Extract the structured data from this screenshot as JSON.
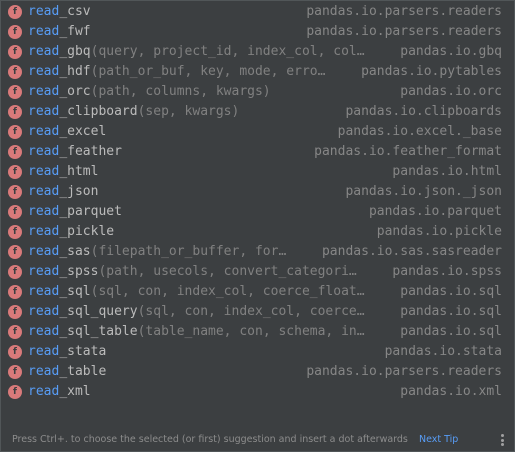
{
  "popup": {
    "match_prefix": "read",
    "icon_letter": "f",
    "items": [
      {
        "suffix": "_csv",
        "params": "",
        "location": "pandas.io.parsers.readers"
      },
      {
        "suffix": "_fwf",
        "params": "",
        "location": "pandas.io.parsers.readers"
      },
      {
        "suffix": "_gbq",
        "params": "(query, project_id, index_col, col…",
        "location": "pandas.io.gbq"
      },
      {
        "suffix": "_hdf",
        "params": "(path_or_buf, key, mode, erro…",
        "location": "pandas.io.pytables"
      },
      {
        "suffix": "_orc",
        "params": "(path, columns, kwargs)",
        "location": "pandas.io.orc"
      },
      {
        "suffix": "_clipboard",
        "params": "(sep, kwargs)",
        "location": "pandas.io.clipboards"
      },
      {
        "suffix": "_excel",
        "params": "",
        "location": "pandas.io.excel._base"
      },
      {
        "suffix": "_feather",
        "params": "",
        "location": "pandas.io.feather_format"
      },
      {
        "suffix": "_html",
        "params": "",
        "location": "pandas.io.html"
      },
      {
        "suffix": "_json",
        "params": "",
        "location": "pandas.io.json._json"
      },
      {
        "suffix": "_parquet",
        "params": "",
        "location": "pandas.io.parquet"
      },
      {
        "suffix": "_pickle",
        "params": "",
        "location": "pandas.io.pickle"
      },
      {
        "suffix": "_sas",
        "params": "(filepath_or_buffer, for…",
        "location": "pandas.io.sas.sasreader"
      },
      {
        "suffix": "_spss",
        "params": "(path, usecols, convert_categori…",
        "location": "pandas.io.spss"
      },
      {
        "suffix": "_sql",
        "params": "(sql, con, index_col, coerce_float…",
        "location": "pandas.io.sql"
      },
      {
        "suffix": "_sql_query",
        "params": "(sql, con, index_col, coerce…",
        "location": "pandas.io.sql"
      },
      {
        "suffix": "_sql_table",
        "params": "(table_name, con, schema, in…",
        "location": "pandas.io.sql"
      },
      {
        "suffix": "_stata",
        "params": "",
        "location": "pandas.io.stata"
      },
      {
        "suffix": "_table",
        "params": "",
        "location": "pandas.io.parsers.readers"
      },
      {
        "suffix": "_xml",
        "params": "",
        "location": "pandas.io.xml"
      }
    ]
  },
  "footer": {
    "hint": "Press Ctrl+. to choose the selected (or first) suggestion and insert a dot afterwards",
    "next_tip": "Next Tip",
    "more_icon": "vertical-ellipsis-icon"
  },
  "colors": {
    "background": "#3c3f41",
    "match": "#589df6",
    "function_icon": "#d87a7a",
    "location_text": "#868686",
    "params_text": "#808080"
  }
}
